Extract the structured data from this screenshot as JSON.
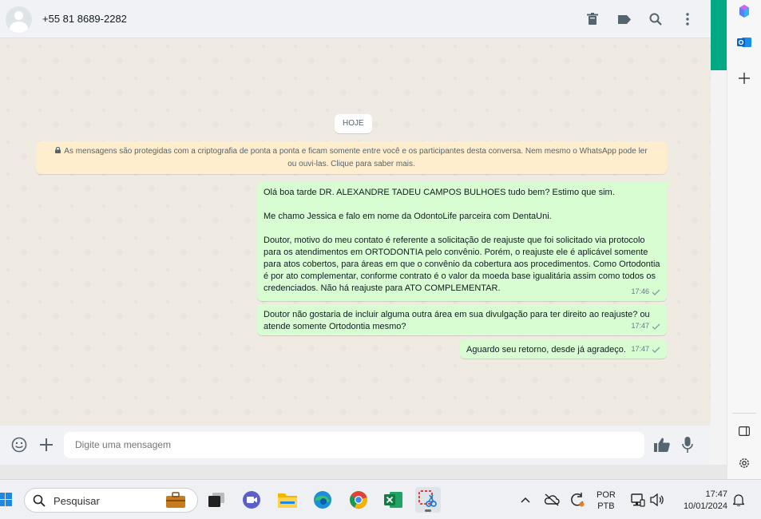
{
  "header": {
    "contact_name": "+55 81 8689-2282"
  },
  "chat": {
    "date_chip": "HOJE",
    "encryption_notice": "As mensagens são protegidas com a criptografia de ponta a ponta e ficam somente entre você e os participantes desta conversa. Nem mesmo o WhatsApp pode ler ou ouvi-las. Clique para saber mais.",
    "messages": [
      {
        "text": "Olá boa tarde DR. ALEXANDRE TADEU CAMPOS BULHOES tudo bem? Estimo que sim.\n\nMe chamo Jessica e falo em nome da OdontoLife parceira com DentaUni.\n\nDoutor, motivo do meu contato é referente a solicitação de reajuste que foi solicitado via protocolo para os atendimentos em ORTODONTIA pelo convênio. Porém, o reajuste ele é aplicável somente para atos cobertos, para áreas em que o convênio da cobertura aos procedimentos. Como Ortodontia é por ato complementar, conforme contrato é o valor da moeda base igualitária assim como todos os credenciados. Não há reajuste para ATO COMPLEMENTAR.",
        "time": "17:46"
      },
      {
        "text": "Doutor não gostaria de incluir alguma outra área em sua divulgação para ter direito ao reajuste? ou atende somente Ortodontia mesmo?",
        "time": "17:47"
      },
      {
        "text": "Aguardo seu retorno, desde já agradeço.",
        "time": "17:47"
      }
    ]
  },
  "composer": {
    "placeholder": "Digite uma mensagem"
  },
  "taskbar": {
    "search_label": "Pesquisar",
    "language_line1": "POR",
    "language_line2": "PTB",
    "time": "17:47",
    "date": "10/01/2024"
  },
  "colors": {
    "outgoing_bubble": "#d9fdd3",
    "accent": "#00a884",
    "chat_background": "#efeae2",
    "notice_background": "#ffeecd"
  }
}
